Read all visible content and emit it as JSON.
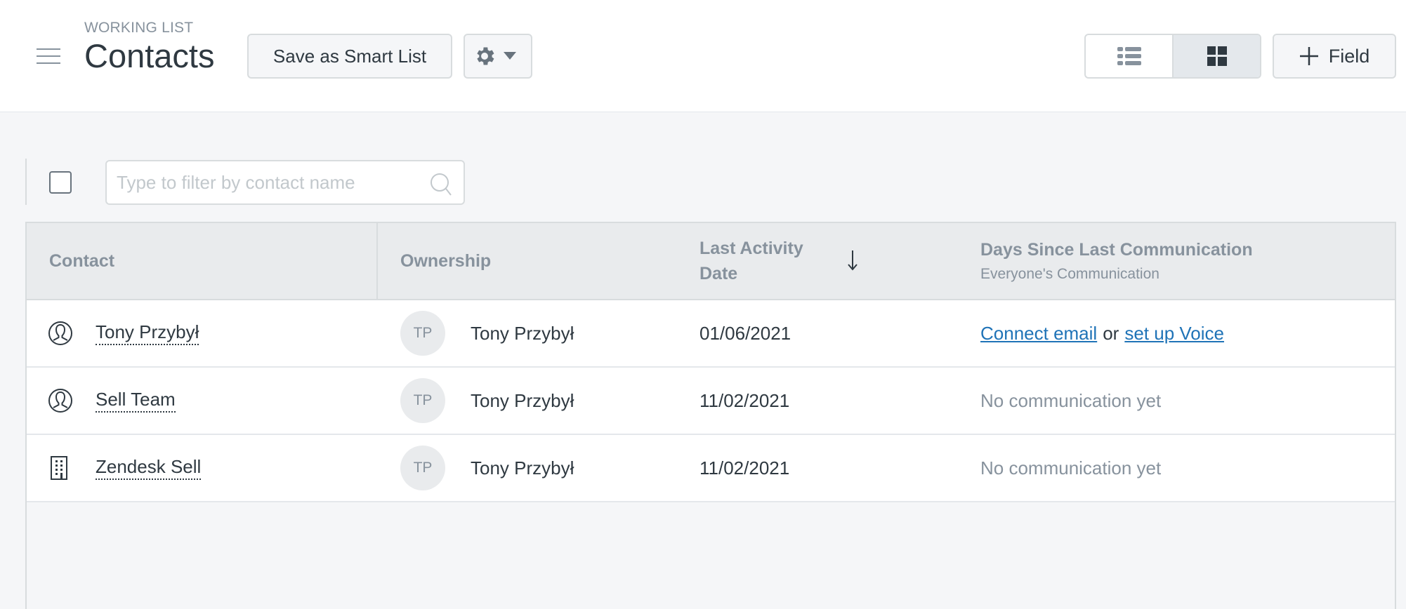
{
  "header": {
    "eyebrow": "WORKING LIST",
    "title": "Contacts",
    "save_smart_list_label": "Save as Smart List",
    "add_field_label": "Field",
    "view_toggle": {
      "options": [
        "list-view",
        "grid-view"
      ],
      "active": "grid-view"
    }
  },
  "toolbar": {
    "search_placeholder": "Type to filter by contact name",
    "search_value": ""
  },
  "table": {
    "columns": {
      "contact": "Contact",
      "ownership": "Ownership",
      "last_activity": "Last Activity Date",
      "days_since": "Days Since Last Communication",
      "days_since_sub": "Everyone's Communication"
    },
    "sort": {
      "column": "last_activity",
      "direction": "descending"
    },
    "rows": [
      {
        "type": "person",
        "name": "Tony Przybył",
        "owner_initials": "TP",
        "owner": "Tony Przybył",
        "last_activity": "01/06/2021",
        "days_since": null,
        "connect_email": "Connect email",
        "or": "or",
        "setup_voice": "set up Voice"
      },
      {
        "type": "person",
        "name": "Sell Team",
        "owner_initials": "TP",
        "owner": "Tony Przybył",
        "last_activity": "11/02/2021",
        "days_since": "No communication yet"
      },
      {
        "type": "company",
        "name": "Zendesk Sell",
        "owner_initials": "TP",
        "owner": "Tony Przybył",
        "last_activity": "11/02/2021",
        "days_since": "No communication yet"
      }
    ]
  },
  "colors": {
    "link": "#1f73b7",
    "text": "#2f3941",
    "muted": "#87929d",
    "header_bg": "#e9ebed",
    "page_bg": "#f5f6f8"
  }
}
